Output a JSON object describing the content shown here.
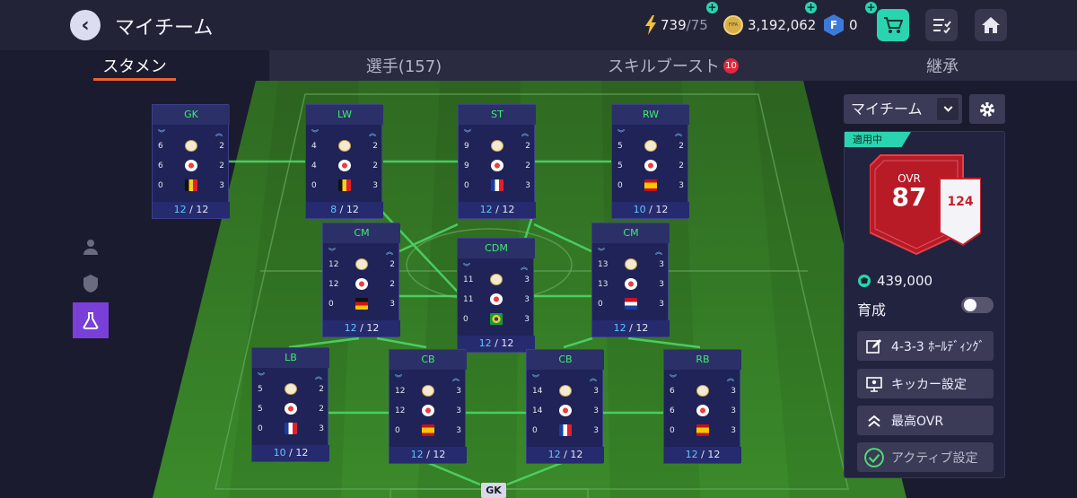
{
  "header": {
    "title": "マイチーム",
    "stamina": "739",
    "stamina_max": "/75",
    "coins": "3,192,062",
    "fp": "0"
  },
  "tabs": [
    {
      "label": "スタメン"
    },
    {
      "label": "選手(157)"
    },
    {
      "label": "スキルブースト",
      "badge": "10"
    },
    {
      "label": "継承"
    }
  ],
  "pitch": {
    "bottom_label": "GK"
  },
  "cards": [
    {
      "pos": "GK",
      "rows": [
        [
          "6",
          "2"
        ],
        [
          "6",
          "2"
        ],
        [
          "0",
          "3"
        ]
      ],
      "flag": "belgium",
      "level": "12",
      "level_max": "/ 12"
    },
    {
      "pos": "LW",
      "rows": [
        [
          "4",
          "2"
        ],
        [
          "4",
          "2"
        ],
        [
          "0",
          "3"
        ]
      ],
      "flag": "belgium",
      "level": "8",
      "level_max": "/ 12"
    },
    {
      "pos": "ST",
      "rows": [
        [
          "9",
          "2"
        ],
        [
          "9",
          "2"
        ],
        [
          "0",
          "3"
        ]
      ],
      "flag": "france",
      "level": "12",
      "level_max": "/ 12"
    },
    {
      "pos": "RW",
      "rows": [
        [
          "5",
          "2"
        ],
        [
          "5",
          "2"
        ],
        [
          "0",
          "3"
        ]
      ],
      "flag": "spain",
      "level": "10",
      "level_max": "/ 12"
    },
    {
      "pos": "CM",
      "rows": [
        [
          "12",
          "2"
        ],
        [
          "12",
          "2"
        ],
        [
          "0",
          "3"
        ]
      ],
      "flag": "germany",
      "level": "12",
      "level_max": "/ 12"
    },
    {
      "pos": "CDM",
      "rows": [
        [
          "11",
          "3"
        ],
        [
          "11",
          "3"
        ],
        [
          "0",
          "3"
        ]
      ],
      "flag": "brazil",
      "level": "12",
      "level_max": "/ 12"
    },
    {
      "pos": "CM",
      "rows": [
        [
          "13",
          "3"
        ],
        [
          "13",
          "3"
        ],
        [
          "0",
          "3"
        ]
      ],
      "flag": "croatia",
      "level": "12",
      "level_max": "/ 12"
    },
    {
      "pos": "LB",
      "rows": [
        [
          "5",
          "2"
        ],
        [
          "5",
          "2"
        ],
        [
          "0",
          "3"
        ]
      ],
      "flag": "france",
      "level": "10",
      "level_max": "/ 12"
    },
    {
      "pos": "CB",
      "rows": [
        [
          "12",
          "3"
        ],
        [
          "12",
          "3"
        ],
        [
          "0",
          "3"
        ]
      ],
      "flag": "spain",
      "level": "12",
      "level_max": "/ 12"
    },
    {
      "pos": "CB",
      "rows": [
        [
          "14",
          "3"
        ],
        [
          "14",
          "3"
        ],
        [
          "0",
          "3"
        ]
      ],
      "flag": "france",
      "level": "12",
      "level_max": "/ 12"
    },
    {
      "pos": "RB",
      "rows": [
        [
          "6",
          "3"
        ],
        [
          "6",
          "3"
        ],
        [
          "0",
          "3"
        ]
      ],
      "flag": "spain",
      "level": "12",
      "level_max": "/ 12"
    }
  ],
  "right_panel": {
    "team_select": "マイチーム",
    "applied_label": "適用中",
    "ovr_label": "OVR",
    "ovr": "87",
    "sub_ovr": "124",
    "value": "439,000",
    "training_label": "育成",
    "training_on": false,
    "buttons": [
      "4-3-3 ﾎｰﾙﾃﾞｨﾝｸﾞ",
      "キッカー設定",
      "最高OVR",
      "アクティブ設定"
    ]
  },
  "colors": {
    "accent": "#2ad4b0",
    "tab_underline": "#f0602a",
    "badge": "#e0283c",
    "pitch_light": "#3f8a2e",
    "pitch_dark": "#2b6520",
    "position_text": "#3cf06a",
    "ovr_red": "#c8202c"
  }
}
